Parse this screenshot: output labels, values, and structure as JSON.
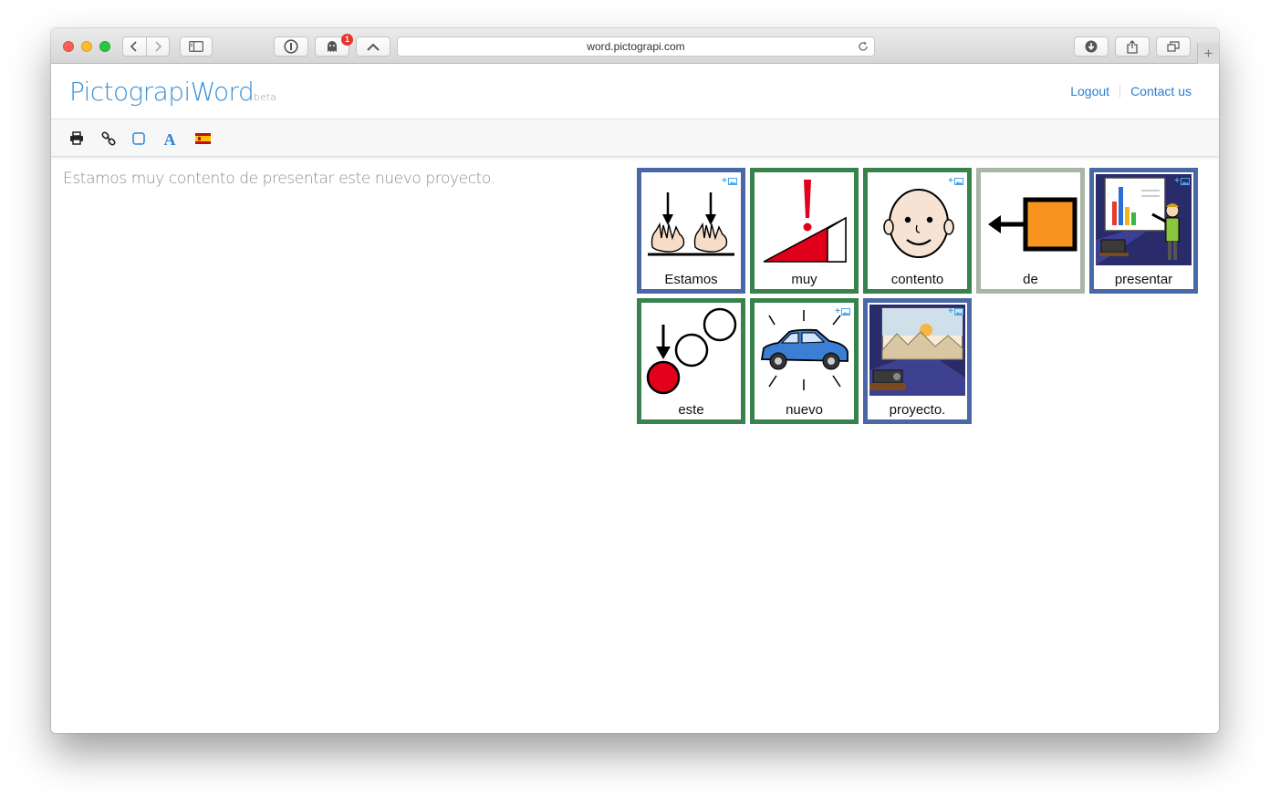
{
  "browser": {
    "url": "word.pictograpi.com",
    "notification_count": "1"
  },
  "header": {
    "logo_main": "PictograpiWord",
    "logo_beta": "beta",
    "logout": "Logout",
    "contact": "Contact us"
  },
  "toolbar": {
    "icons": [
      "print-icon",
      "link-icon",
      "square-border-icon",
      "font-icon",
      "spanish-flag-icon"
    ]
  },
  "colors": {
    "accent": "#3a90d6",
    "card_blue": "#4a68a6",
    "card_green": "#38824e",
    "card_grey": "#a8b6a6"
  },
  "sentence": "Estamos muy contento de presentar este nuevo proyecto.",
  "cards": [
    {
      "word": "Estamos",
      "border": "blue",
      "pictogram": "hands-down-icon",
      "add_image": true
    },
    {
      "word": "muy",
      "border": "green",
      "pictogram": "intensity-exclamation-icon",
      "add_image": false
    },
    {
      "word": "contento",
      "border": "green",
      "pictogram": "happy-face-icon",
      "add_image": true
    },
    {
      "word": "de",
      "border": "grey",
      "pictogram": "arrow-from-square-icon",
      "add_image": false
    },
    {
      "word": "presentar",
      "border": "blue",
      "pictogram": "presenter-icon",
      "add_image": true
    },
    {
      "word": "este",
      "border": "green",
      "pictogram": "this-one-circles-icon",
      "add_image": false
    },
    {
      "word": "nuevo",
      "border": "green",
      "pictogram": "new-car-icon",
      "add_image": true
    },
    {
      "word": "proyecto.",
      "border": "blue",
      "pictogram": "projector-screen-icon",
      "add_image": true
    }
  ],
  "add_image_label": "+"
}
